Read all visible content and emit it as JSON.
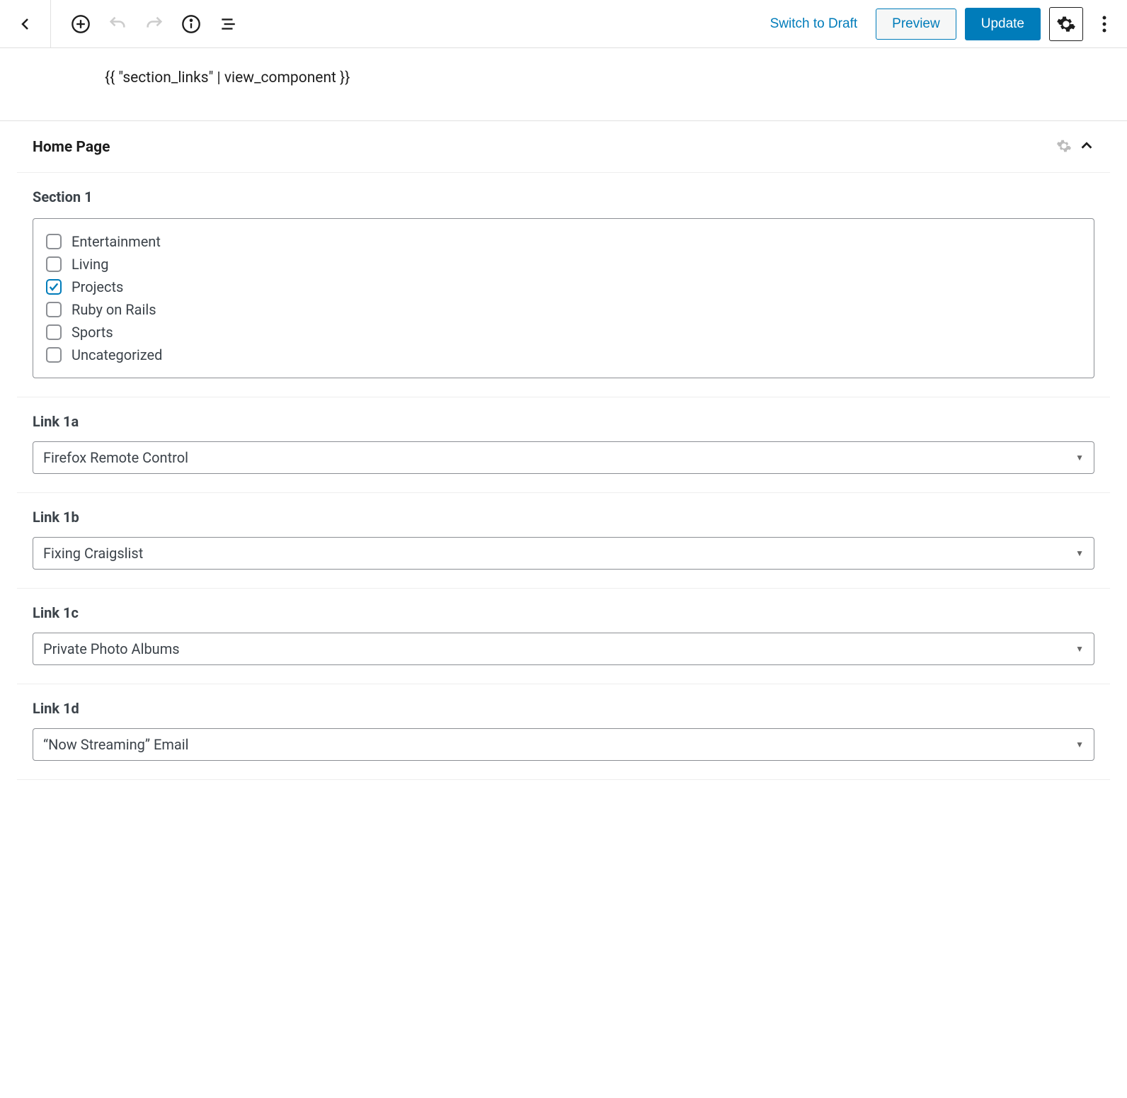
{
  "toolbar": {
    "switch_draft": "Switch to Draft",
    "preview": "Preview",
    "update": "Update"
  },
  "template_text": "{{ \"section_links\" | view_component }}",
  "panel": {
    "title": "Home Page"
  },
  "section1": {
    "label": "Section 1",
    "categories": [
      {
        "label": "Entertainment",
        "checked": false
      },
      {
        "label": "Living",
        "checked": false
      },
      {
        "label": "Projects",
        "checked": true
      },
      {
        "label": "Ruby on Rails",
        "checked": false
      },
      {
        "label": "Sports",
        "checked": false
      },
      {
        "label": "Uncategorized",
        "checked": false
      }
    ]
  },
  "links": [
    {
      "label": "Link 1a",
      "value": "Firefox Remote Control"
    },
    {
      "label": "Link 1b",
      "value": "Fixing Craigslist"
    },
    {
      "label": "Link 1c",
      "value": "Private Photo Albums"
    },
    {
      "label": "Link 1d",
      "value": "“Now Streaming” Email"
    }
  ]
}
